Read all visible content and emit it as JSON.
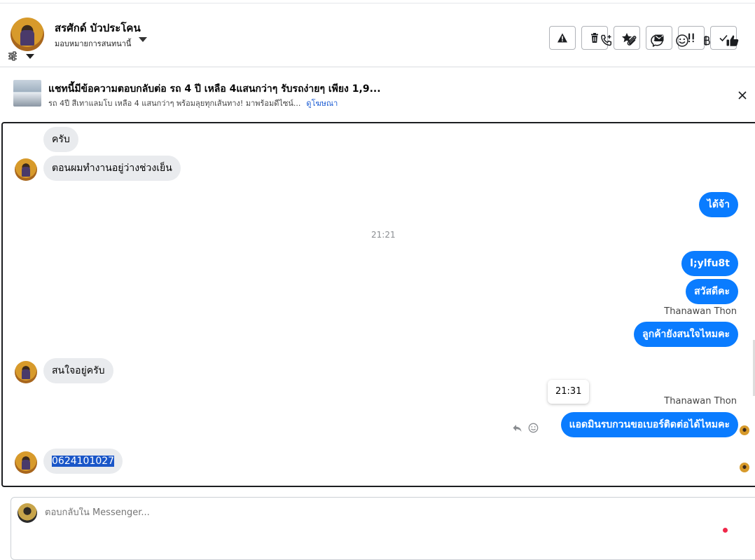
{
  "header": {
    "contact_name": "สรศักด์ บัวประโคน",
    "assign_label": "มอบหมายการสนทนานี้",
    "actions": [
      {
        "name": "report-button",
        "icon": "warning-icon"
      },
      {
        "name": "delete-button",
        "icon": "trash-icon"
      },
      {
        "name": "star-button",
        "icon": "star-icon"
      },
      {
        "name": "mark-unread-button",
        "icon": "envelope-icon"
      },
      {
        "name": "follow-up-button",
        "icon": "double-exclamation-icon"
      },
      {
        "name": "mark-done-button",
        "icon": "check-icon"
      }
    ]
  },
  "ad": {
    "title": "แชทนี้มีข้อความตอบกลับต่อ รถ 4 ปี เหลือ 4แสนกว่าๆ รับรถง่ายๆ เพียง 1,9...",
    "subtitle": "รถ 4ปี สีเทาแลมโบ เหลือ 4 แสนกว่าๆ พร้อมลุยทุกเส้นทาง! มาพร้อมดีไซน์...",
    "link": "ดูโฆษณา"
  },
  "messages": {
    "m1": "ครับ",
    "m2": "ตอนผมทำงานอยู่ว่างช่วงเย็น",
    "m3": "ได้จ้า",
    "timestamp": "21:21",
    "m4": "l;ylfu8t",
    "m5": "สวัสดีคะ",
    "sender1": "Thanawan Thon",
    "m6": "ลูกค้ายังสนใจไหมคะ",
    "m7": "สนใจอยู่ครับ",
    "tooltip_time": "21:31",
    "sender2": "Thanawan Thon",
    "m8": "แอดมินรบกวนขอเบอร์ติดต่อได้ไหมคะ",
    "m9": "0624101027"
  },
  "composer": {
    "placeholder": "ตอบกลับใน Messenger..."
  },
  "colors": {
    "outgoing_bubble": "#0a7cff",
    "incoming_bubble": "#e9ebee",
    "link": "#1a5bd3",
    "notification_dot": "#f0284a"
  }
}
